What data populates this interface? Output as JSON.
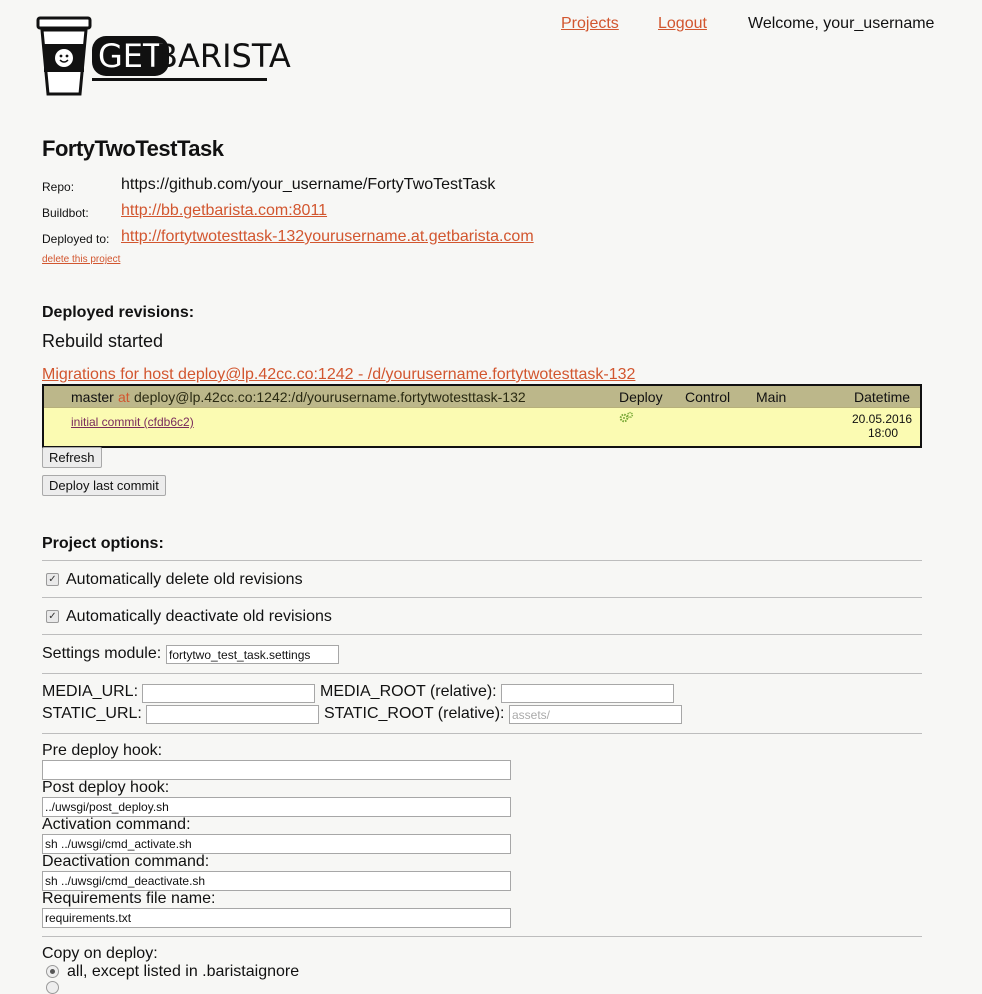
{
  "header": {
    "logo_text_get": "GET",
    "logo_text_barista": "BARISTA",
    "nav_projects": "Projects",
    "nav_logout": "Logout",
    "welcome": "Welcome, your_username"
  },
  "project": {
    "title": "FortyTwoTestTask",
    "repo_label": "Repo:",
    "repo_value": "https://github.com/your_username/FortyTwoTestTask",
    "buildbot_label": "Buildbot:",
    "buildbot_value": "http://bb.getbarista.com:8011",
    "deployed_label": "Deployed to:",
    "deployed_value": "http://fortytwotesttask-132yourusername.at.getbarista.com",
    "delete_link": "delete this project"
  },
  "revisions": {
    "heading": "Deployed revisions:",
    "status": "Rebuild started",
    "migrations_link": "Migrations for host deploy@lp.42cc.co:1242 - /d/yourusername.fortytwotesttask-132",
    "branch": "master",
    "at_word": "at",
    "host_path": "deploy@lp.42cc.co:1242:/d/yourusername.fortytwotesttask-132",
    "col_deploy": "Deploy",
    "col_control": "Control",
    "col_main": "Main",
    "col_datetime": "Datetime",
    "commit_link": "initial commit (cfdb6c2)",
    "commit_date": "20.05.2016",
    "commit_time": "18:00",
    "refresh_button": "Refresh",
    "deploy_last_button": "Deploy last commit"
  },
  "options": {
    "heading": "Project options:",
    "auto_delete_label": "Automatically delete old revisions",
    "auto_delete_checked": true,
    "auto_deactivate_label": "Automatically deactivate old revisions",
    "auto_deactivate_checked": true,
    "settings_label": "Settings module:",
    "settings_value": "fortytwo_test_task.settings",
    "media_url_label": "MEDIA_URL:",
    "media_url_value": "",
    "media_root_label": "MEDIA_ROOT (relative):",
    "media_root_value": "",
    "static_url_label": "STATIC_URL:",
    "static_url_value": "",
    "static_root_label": "STATIC_ROOT (relative):",
    "static_root_placeholder": "assets/",
    "pre_hook_label": "Pre deploy hook:",
    "pre_hook_value": "",
    "post_hook_label": "Post deploy hook:",
    "post_hook_value": "../uwsgi/post_deploy.sh",
    "activation_label": "Activation command:",
    "activation_value": "sh ../uwsgi/cmd_activate.sh",
    "deactivation_label": "Deactivation command:",
    "deactivation_value": "sh ../uwsgi/cmd_deactivate.sh",
    "requirements_label": "Requirements file name:",
    "requirements_value": "requirements.txt",
    "copy_label": "Copy on deploy:",
    "copy_option_1": "all, except listed in .baristaignore"
  },
  "colors": {
    "link": "#d2562f",
    "table_header": "#bcb78a",
    "table_body": "#fbfbb2",
    "gear": "#7dab3b"
  },
  "icons": {
    "logo": "coffee-cup-icon",
    "deploy": "gear-icon"
  }
}
